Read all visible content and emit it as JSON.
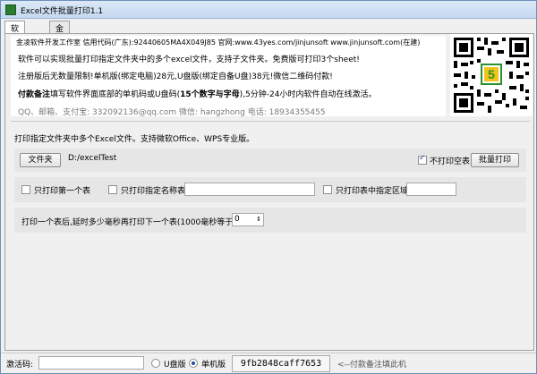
{
  "window": {
    "title": "Excel文件批量打印1.1"
  },
  "tabs": [
    {
      "label": "软件设置",
      "active": true
    },
    {
      "label": "金凌软件",
      "active": false
    }
  ],
  "info": {
    "company_line": "金凌软件开发工作室  信用代码(广东):92440605MA4X049J85  官网:www.43yes.com/jinjunsoft  www.jinjunsoft.com(在建)",
    "desc_line": "软件可以实现批量打印指定文件夹中的多个excel文件，支持子文件夹。免费版可打印3个sheet!",
    "price_line": "注册版后无数量限制!单机版(绑定电脑)28元,U盘版(绑定自备U盘)38元!微信二维码付款!",
    "note_bold": "付款备注",
    "note_middle": "填写软件界面底部的单机码或U盘码(",
    "note_bold2": "15个数字与字母",
    "note_end": "),5分钟-24小时内软件自动在线激活。",
    "contact_line": "QQ、邮箱、支付宝: 332092136@qq.com      微信: hangzhong      电话: 18934355455"
  },
  "qr": {
    "accent": "#2f8f2f",
    "badge_color": "#f0c419"
  },
  "section": {
    "label": "打印指定文件夹中多个Excel文件。支持微软Office、WPS专业版。"
  },
  "folder_row": {
    "folder_button": "文件夹",
    "folder_path": "D:/excelTest",
    "skip_blank_label": "不打印空表",
    "skip_blank_checked": true,
    "batch_print_button": "批量打印"
  },
  "options_row": {
    "first_sheet_label": "只打印第一个表",
    "named_sheet_label": "只打印指定名称表:",
    "named_sheet_value": "",
    "area_label": "只打印表中指定区域:",
    "area_value": ""
  },
  "delay_row": {
    "label": "打印一个表后,延时多少毫秒再打印下一个表(1000毫秒等于1秒):",
    "value": "0"
  },
  "statusbar": {
    "activation_label": "激活码:",
    "activation_value": "",
    "usb_label": "U盘版",
    "usb_checked": false,
    "single_label": "单机版",
    "single_checked": true,
    "machine_code": "9fb2848caff7653",
    "hint": "<--付款备注填此机"
  }
}
